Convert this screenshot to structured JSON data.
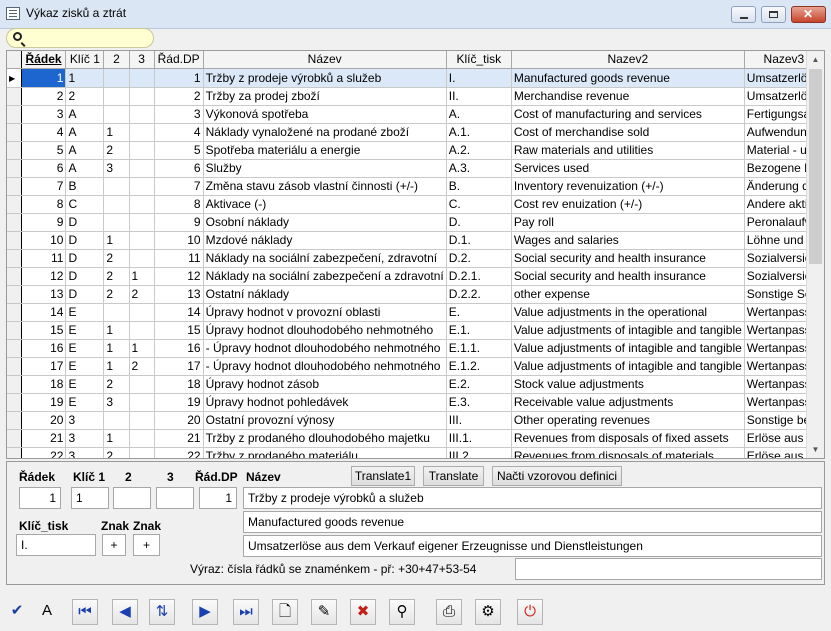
{
  "window": {
    "title": "Výkaz zisků a ztrát"
  },
  "grid": {
    "columns": [
      "Řádek",
      "Klíč 1",
      "2",
      "3",
      "Řád.DP",
      "Název",
      "Klíč_tisk",
      "Nazev2",
      "Nazev3"
    ],
    "rows": [
      [
        "1",
        "1",
        "",
        "",
        "1",
        "Tržby z prodeje výrobků a služeb",
        "I.",
        "Manufactured goods revenue",
        "Umsatzerlös"
      ],
      [
        "2",
        "2",
        "",
        "",
        "2",
        "Tržby za prodej zboží",
        "II.",
        "Merchandise revenue",
        "Umsatzerlös"
      ],
      [
        "3",
        "A",
        "",
        "",
        "3",
        "Výkonová spotřeba",
        "A.",
        "Cost of manufacturing and services",
        "Fertigungsau"
      ],
      [
        "4",
        "A",
        "1",
        "",
        "4",
        "Náklady vynaložené na prodané zboží",
        "A.1.",
        "Cost of merchandise sold",
        "Aufwendunge"
      ],
      [
        "5",
        "A",
        "2",
        "",
        "5",
        "Spotřeba materiálu a energie",
        "A.2.",
        "Raw materials and utilities",
        "Material - und"
      ],
      [
        "6",
        "A",
        "3",
        "",
        "6",
        "Služby",
        "A.3.",
        "Services used",
        "Bezogene Di"
      ],
      [
        "7",
        "B",
        "",
        "",
        "7",
        "Změna stavu zásob vlastní činnosti (+/-)",
        "B.",
        "Inventory revenuization (+/-)",
        "Änderung de"
      ],
      [
        "8",
        "C",
        "",
        "",
        "8",
        "Aktivace (-)",
        "C.",
        "Cost rev enuization (+/-)",
        "Andere aktivi"
      ],
      [
        "9",
        "D",
        "",
        "",
        "9",
        "Osobní náklady",
        "D.",
        "Pay roll",
        "Peronalaufwa"
      ],
      [
        "10",
        "D",
        "1",
        "",
        "10",
        "Mzdové náklady",
        "D.1.",
        "Wages and salaries",
        "Löhne und G"
      ],
      [
        "11",
        "D",
        "2",
        "",
        "11",
        "Náklady na sociální zabezpečení, zdravotní",
        "D.2.",
        "Social security and health insurance",
        "Sozialversich"
      ],
      [
        "12",
        "D",
        "2",
        "1",
        "12",
        "Náklady na sociální zabezpečení a zdravotní",
        "D.2.1.",
        "Social security and health insurance",
        "Sozialversich"
      ],
      [
        "13",
        "D",
        "2",
        "2",
        "13",
        "Ostatní náklady",
        "D.2.2.",
        "other expense",
        "Sonstige Soz"
      ],
      [
        "14",
        "E",
        "",
        "",
        "14",
        "Úpravy hodnot v provozní oblasti",
        "E.",
        "Value adjustments in the operational",
        "Wertanpassu"
      ],
      [
        "15",
        "E",
        "1",
        "",
        "15",
        "Úpravy hodnot dlouhodobého nehmotného",
        "E.1.",
        "Value adjustments of intagible and tangible",
        "Wertanpassu"
      ],
      [
        "16",
        "E",
        "1",
        "1",
        "16",
        "- Úpravy hodnot dlouhodobého nehmotného",
        "E.1.1.",
        "Value adjustments of intagible and tangible",
        "Wertanpassu"
      ],
      [
        "17",
        "E",
        "1",
        "2",
        "17",
        "- Úpravy hodnot dlouhodobého nehmotného",
        "E.1.2.",
        "Value adjustments of intagible and tangible",
        "Wertanpassu"
      ],
      [
        "18",
        "E",
        "2",
        "",
        "18",
        "Úpravy hodnot zásob",
        "E.2.",
        "Stock value adjustments",
        "Wertanpassu"
      ],
      [
        "19",
        "E",
        "3",
        "",
        "19",
        "Úpravy hodnot pohledávek",
        "E.3.",
        "Receivable value adjustments",
        "Wertanpassu"
      ],
      [
        "20",
        "3",
        "",
        "",
        "20",
        "Ostatní provozní výnosy",
        "III.",
        "Other operating revenues",
        "Sonstige betr"
      ],
      [
        "21",
        "3",
        "1",
        "",
        "21",
        "Tržby z prodaného dlouhodobého majetku",
        "III.1.",
        "Revenues from disposals of fixed assets",
        "Erlöse aus d"
      ],
      [
        "22",
        "3",
        "2",
        "",
        "22",
        "Tržby z prodaného materiálu",
        "III.2.",
        "Revenues from disposals of materials",
        "Erlöse aus d"
      ]
    ]
  },
  "form": {
    "labels": {
      "radek": "Řádek",
      "klic1": "Klíč 1",
      "k2": "2",
      "k3": "3",
      "raddp": "Řád.DP",
      "nazev": "Název",
      "klic_tisk": "Klíč_tisk",
      "znak1": "Znak",
      "znak2": "Znak"
    },
    "buttons": {
      "translate1": "Translate1",
      "translate": "Translate",
      "nacti": "Načti vzorovou definici"
    },
    "values": {
      "radek": "1",
      "klic1": "1",
      "k2": "",
      "k3": "",
      "raddp": "1",
      "nazev": "Tržby z prodeje výrobků a služeb",
      "nazev2": "Manufactured goods revenue",
      "nazev3": "Umsatzerlöse aus dem Verkauf eigener Erzeugnisse und Dienstleistungen",
      "klic_tisk": "I.",
      "znak1": "+",
      "znak2": "+",
      "vyraz": ""
    },
    "vyraz_label": "Výraz: čísla řádků se znaménkem - př:  +30+47+53-54"
  },
  "toolbar": [
    "confirm-icon",
    "font-icon",
    "first-record-icon",
    "prev-record-icon",
    "sort-az-icon",
    "next-record-icon",
    "last-record-icon",
    "new-document-icon",
    "edit-icon",
    "delete-icon",
    "binoculars-icon",
    "print-icon",
    "print-setup-icon",
    "power-icon"
  ]
}
